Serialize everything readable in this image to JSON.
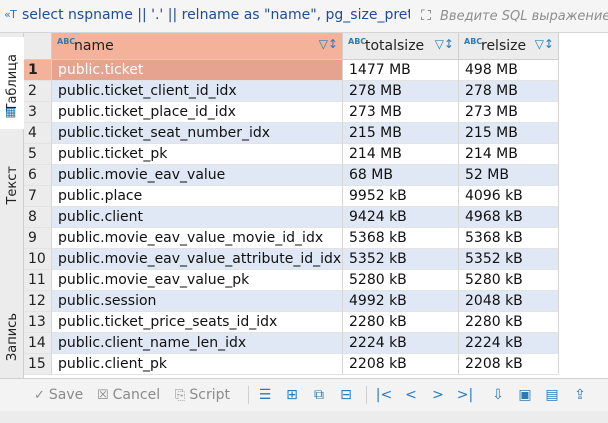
{
  "query_text": "select nspname || '.' || relname as \"name\", pg_size_pretty(pg_relation_size(C.oid))",
  "sql_filter_placeholder": "Введите SQL выражение",
  "side_tabs": {
    "table": "Таблица",
    "text": "Текст",
    "record": "Запись"
  },
  "columns": [
    {
      "type_icon": "ABC",
      "label": "name"
    },
    {
      "type_icon": "ABC",
      "label": "totalsize"
    },
    {
      "type_icon": "ABC",
      "label": "relsize"
    }
  ],
  "rows": [
    {
      "n": "1",
      "name": "public.ticket",
      "totalsize": "1477 MB",
      "relsize": "498 MB"
    },
    {
      "n": "2",
      "name": "public.ticket_client_id_idx",
      "totalsize": "278 MB",
      "relsize": "278 MB"
    },
    {
      "n": "3",
      "name": "public.ticket_place_id_idx",
      "totalsize": "273 MB",
      "relsize": "273 MB"
    },
    {
      "n": "4",
      "name": "public.ticket_seat_number_idx",
      "totalsize": "215 MB",
      "relsize": "215 MB"
    },
    {
      "n": "5",
      "name": "public.ticket_pk",
      "totalsize": "214 MB",
      "relsize": "214 MB"
    },
    {
      "n": "6",
      "name": "public.movie_eav_value",
      "totalsize": "68 MB",
      "relsize": "52 MB"
    },
    {
      "n": "7",
      "name": "public.place",
      "totalsize": "9952 kB",
      "relsize": "4096 kB"
    },
    {
      "n": "8",
      "name": "public.client",
      "totalsize": "9424 kB",
      "relsize": "4968 kB"
    },
    {
      "n": "9",
      "name": "public.movie_eav_value_movie_id_idx",
      "totalsize": "5368 kB",
      "relsize": "5368 kB"
    },
    {
      "n": "10",
      "name": "public.movie_eav_value_attribute_id_idx",
      "totalsize": "5352 kB",
      "relsize": "5352 kB"
    },
    {
      "n": "11",
      "name": "public.movie_eav_value_pk",
      "totalsize": "5280 kB",
      "relsize": "5280 kB"
    },
    {
      "n": "12",
      "name": "public.session",
      "totalsize": "4992 kB",
      "relsize": "2048 kB"
    },
    {
      "n": "13",
      "name": "public.ticket_price_seats_id_idx",
      "totalsize": "2280 kB",
      "relsize": "2280 kB"
    },
    {
      "n": "14",
      "name": "public.client_name_len_idx",
      "totalsize": "2224 kB",
      "relsize": "2224 kB"
    },
    {
      "n": "15",
      "name": "public.client_pk",
      "totalsize": "2208 kB",
      "relsize": "2208 kB"
    }
  ],
  "toolbar": {
    "save": "Save",
    "cancel": "Cancel",
    "script": "Script"
  },
  "colors": {
    "selected_header": "#f4b29a",
    "selected_cell": "#e6a38f",
    "alt_row": "#dfe8f4",
    "accent": "#2a7ab7"
  }
}
